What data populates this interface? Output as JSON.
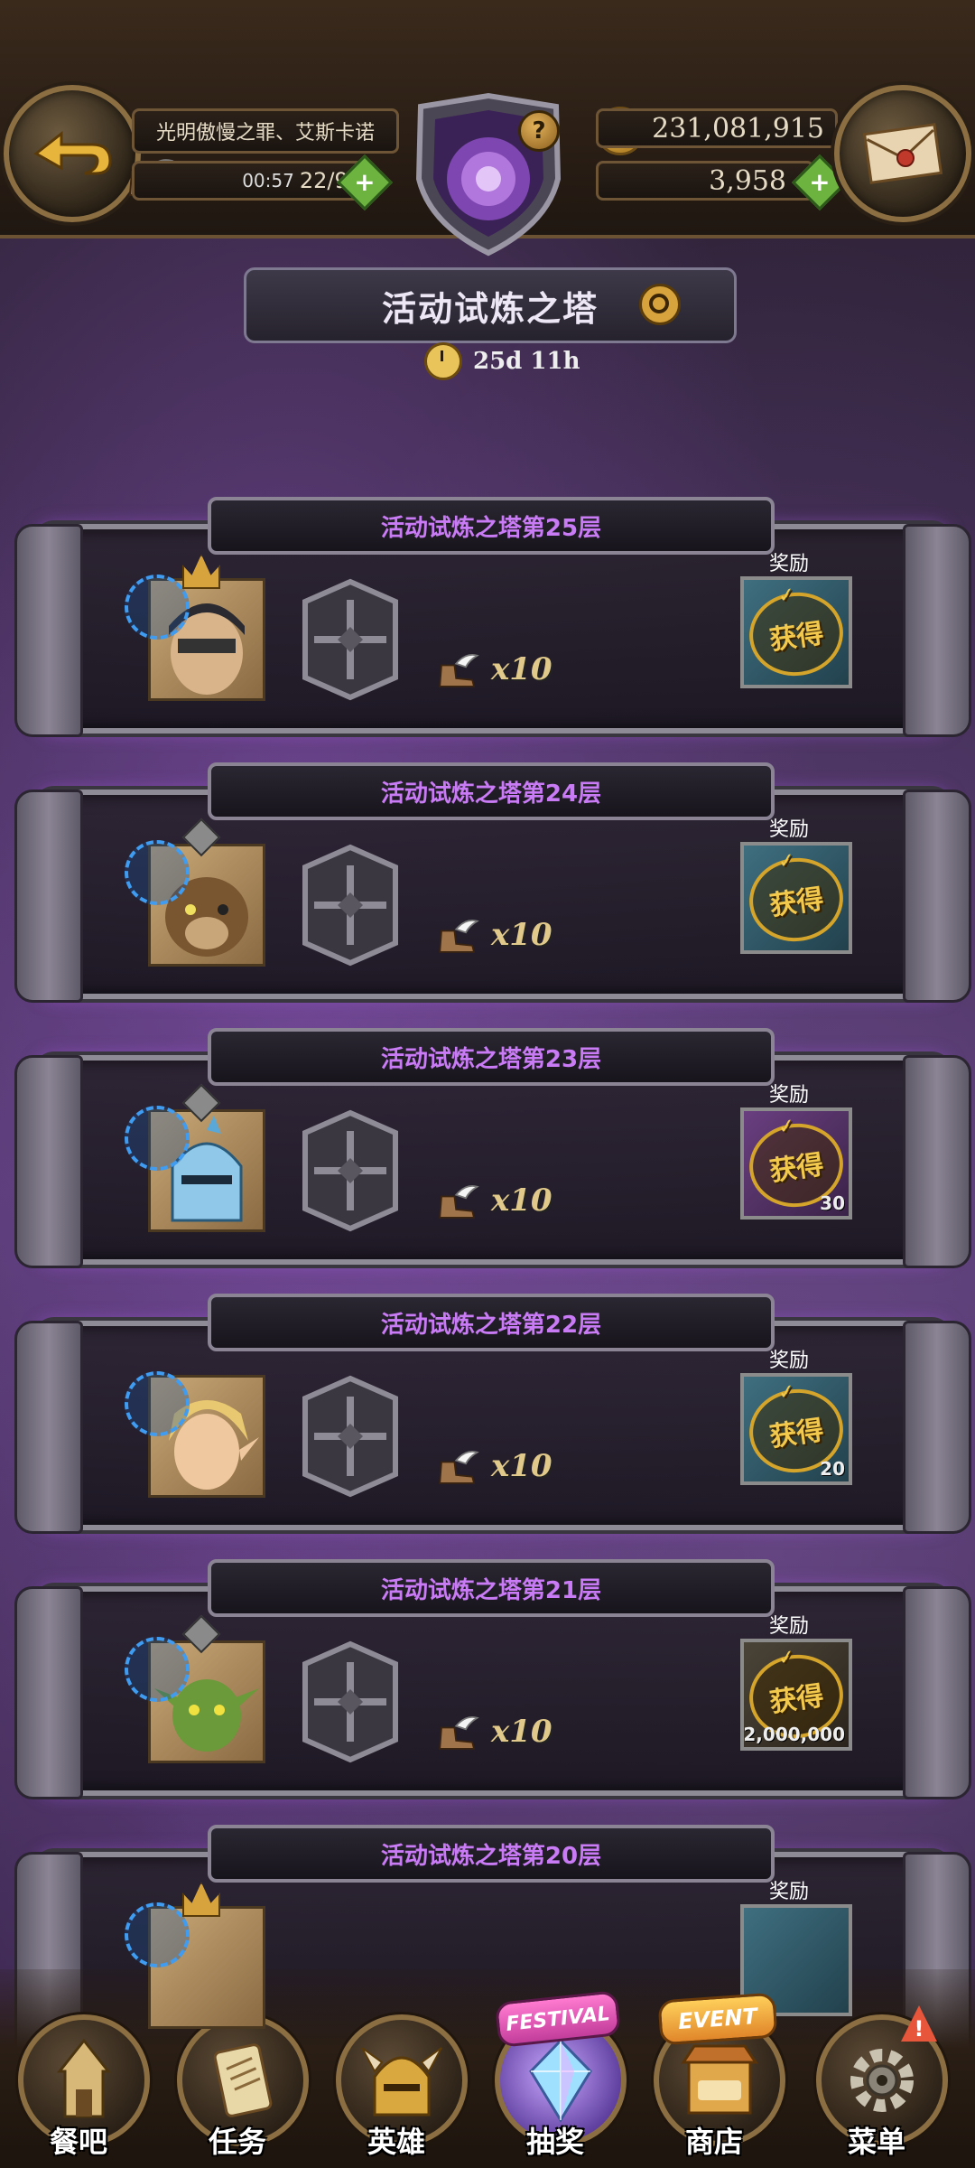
{
  "header": {
    "player_name": "光明傲慢之罪、艾斯卡诺",
    "stamina_timer": "00:57",
    "stamina": "22/92",
    "gold": "231,081,915",
    "gems": "3,958",
    "help": "?"
  },
  "title": {
    "text": "活动试炼之塔",
    "time_remaining": "25d 11h"
  },
  "floors": [
    {
      "title": "活动试炼之塔第25层",
      "cost": "x10",
      "reward_label": "奖励",
      "stamp": "获得",
      "reward_qty": "",
      "boss": true
    },
    {
      "title": "活动试炼之塔第24层",
      "cost": "x10",
      "reward_label": "奖励",
      "stamp": "获得",
      "reward_qty": ""
    },
    {
      "title": "活动试炼之塔第23层",
      "cost": "x10",
      "reward_label": "奖励",
      "stamp": "获得",
      "reward_qty": "30"
    },
    {
      "title": "活动试炼之塔第22层",
      "cost": "x10",
      "reward_label": "奖励",
      "stamp": "获得",
      "reward_qty": "20"
    },
    {
      "title": "活动试炼之塔第21层",
      "cost": "x10",
      "reward_label": "奖励",
      "stamp": "获得",
      "reward_qty": "2,000,000"
    },
    {
      "title": "活动试炼之塔第20层",
      "cost": "",
      "reward_label": "奖励",
      "stamp": "",
      "reward_qty": "",
      "boss": true
    }
  ],
  "nav": [
    {
      "label": "餐吧",
      "icon": "tavern-icon"
    },
    {
      "label": "任务",
      "icon": "quest-scroll-icon"
    },
    {
      "label": "英雄",
      "icon": "hero-helmet-icon"
    },
    {
      "label": "抽奖",
      "icon": "crystal-draw-icon",
      "tag": "FESTIVAL"
    },
    {
      "label": "商店",
      "icon": "shop-icon",
      "tag": "EVENT"
    },
    {
      "label": "菜单",
      "icon": "gear-menu-icon",
      "alert": "!"
    }
  ],
  "colors": {
    "floor_title": "#c97bf5",
    "stamp_gold": "#f2c94c",
    "plus_green": "#6db33f",
    "attribute_blue": "#3f9cf0"
  }
}
